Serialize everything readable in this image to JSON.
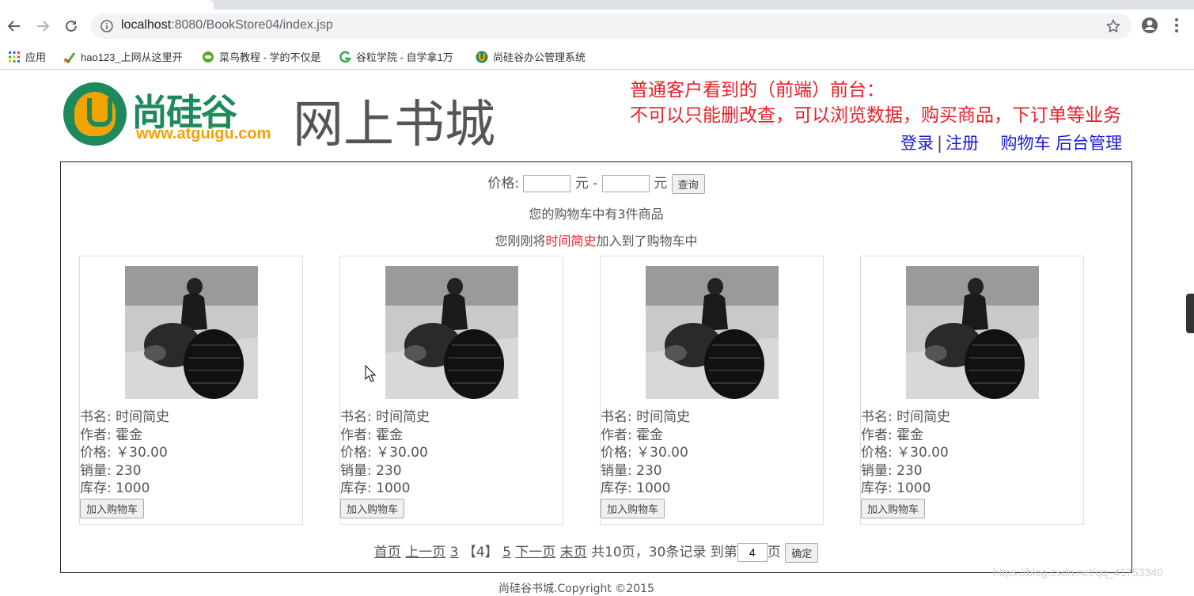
{
  "browser": {
    "url_host": "localhost",
    "url_rest": ":8080/BookStore04/index.jsp",
    "bookmarks": [
      {
        "label": "应用",
        "icon": "apps-grid-icon"
      },
      {
        "label": "hao123_上网从这里开",
        "icon": "hao123-icon"
      },
      {
        "label": "菜鸟教程 - 学的不仅是",
        "icon": "runoob-icon"
      },
      {
        "label": "谷粒学院 - 自学拿1万",
        "icon": "guli-icon"
      },
      {
        "label": "尚硅谷办公管理系统",
        "icon": "atguigu-icon"
      }
    ]
  },
  "header": {
    "logo_cn": "尚硅谷",
    "logo_url": "www.atguigu.com",
    "site_title": "网上书城",
    "note_line1": "普通客户看到的（前端）前台：",
    "note_line2": "不可以只能删改查，可以浏览数据，购买商品，下订单等业务",
    "nav": {
      "login": "登录",
      "sep": "|",
      "register": "注册",
      "cart": "购物车",
      "admin": "后台管理"
    }
  },
  "search": {
    "label": "价格:",
    "min_value": "",
    "unit1": "元 -",
    "max_value": "",
    "unit2": "元",
    "button": "查询"
  },
  "cart_summary": "您的购物车中有3件商品",
  "added": {
    "prefix": "您刚刚将",
    "book": "时间简史",
    "suffix": "加入到了购物车中"
  },
  "books": [
    {
      "name_label": "书名:",
      "name": "时间简史",
      "author_label": "作者:",
      "author": "霍金",
      "price_label": "价格:",
      "price": "￥30.00",
      "sales_label": "销量:",
      "sales": "230",
      "stock_label": "库存:",
      "stock": "1000",
      "button": "加入购物车"
    },
    {
      "name_label": "书名:",
      "name": "时间简史",
      "author_label": "作者:",
      "author": "霍金",
      "price_label": "价格:",
      "price": "￥30.00",
      "sales_label": "销量:",
      "sales": "230",
      "stock_label": "库存:",
      "stock": "1000",
      "button": "加入购物车"
    },
    {
      "name_label": "书名:",
      "name": "时间简史",
      "author_label": "作者:",
      "author": "霍金",
      "price_label": "价格:",
      "price": "￥30.00",
      "sales_label": "销量:",
      "sales": "230",
      "stock_label": "库存:",
      "stock": "1000",
      "button": "加入购物车"
    },
    {
      "name_label": "书名:",
      "name": "时间简史",
      "author_label": "作者:",
      "author": "霍金",
      "price_label": "价格:",
      "price": "￥30.00",
      "sales_label": "销量:",
      "sales": "230",
      "stock_label": "库存:",
      "stock": "1000",
      "button": "加入购物车"
    }
  ],
  "pager": {
    "first": "首页",
    "prev": "上一页",
    "page_prev": "3",
    "current": "【4】",
    "page_next": "5",
    "next": "下一页",
    "last": "末页",
    "summary": "共10页，30条记录",
    "goto_label": "到第",
    "goto_value": "4",
    "page_unit": "页",
    "confirm": "确定"
  },
  "watermark": "https://blog.csdn.net/qq_41753340",
  "footer": "尚硅谷书城.Copyright ©2015",
  "colors": {
    "accent_red": "#e8202a",
    "link_blue": "#1a1ad6",
    "logo_green": "#1e8a5c",
    "logo_orange": "#f3a300"
  }
}
